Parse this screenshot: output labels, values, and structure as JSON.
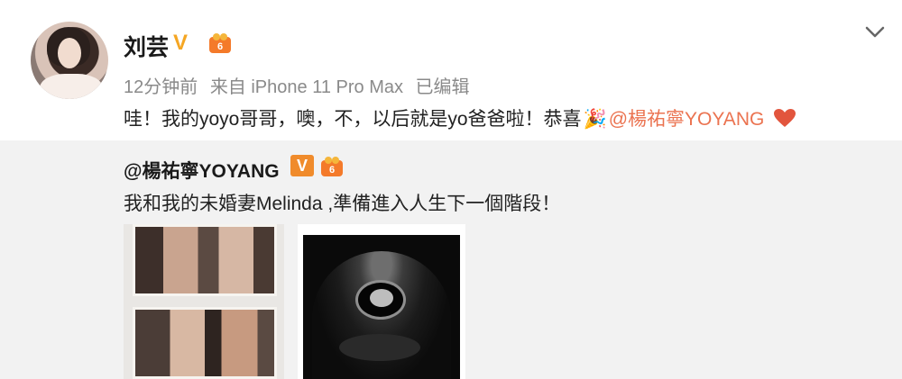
{
  "post": {
    "username": "刘芸",
    "verified_mark": "V",
    "time": "12分钟前",
    "source": "来自 iPhone 11 Pro Max",
    "edited": "已编辑",
    "text": "哇！我的yoyo哥哥，噢，不，以后就是yo爸爸啦！恭喜",
    "confetti": "🎉",
    "mention": "@楊祐寧YOYANG",
    "accent_color": "#eb7350",
    "verified_color": "#f5a623"
  },
  "repost": {
    "username": "@楊祐寧YOYANG",
    "verified_mark": "V",
    "text": "我和我的未婚妻Melinda ,準備進入人生下一個階段！",
    "background": "#f2f2f2"
  },
  "icons": {
    "avatar": "avatar-photo",
    "chevron": "chevron-down-icon",
    "heart": "heart-icon",
    "rank": "member-rank-icon"
  }
}
